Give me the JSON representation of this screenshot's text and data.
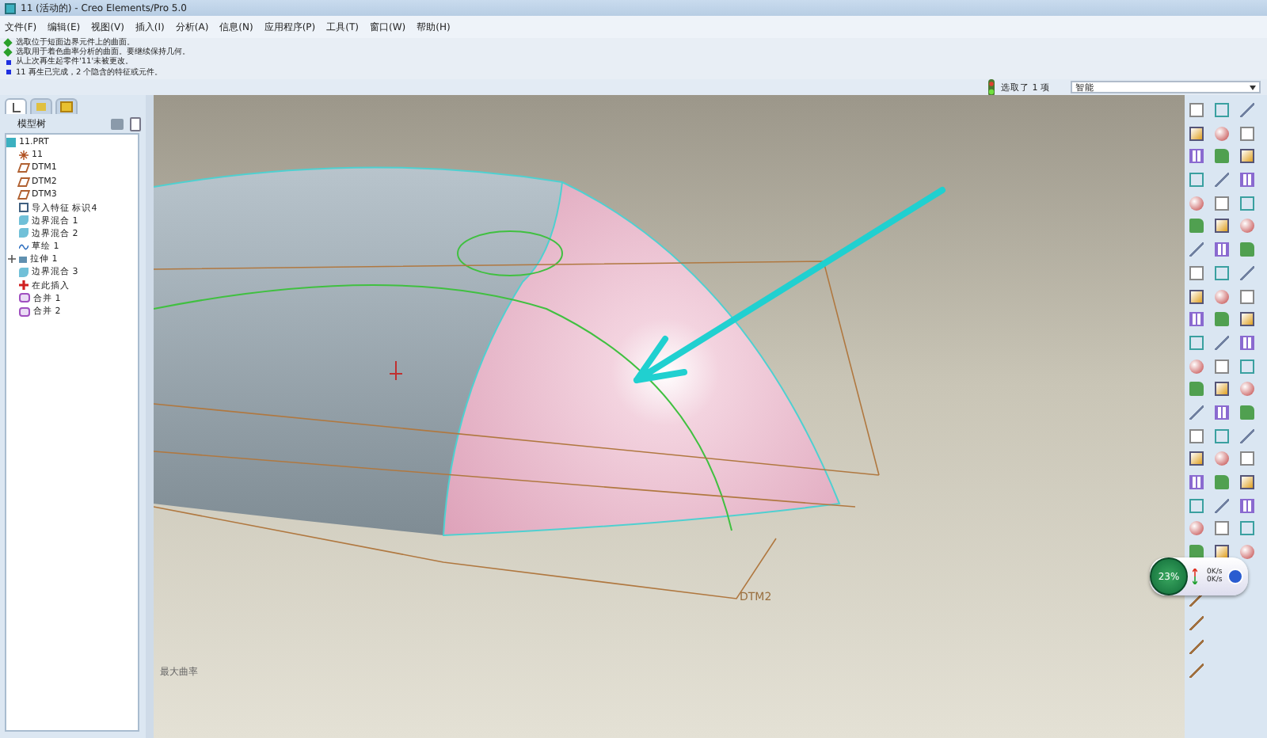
{
  "window": {
    "title": "11 (活动的) - Creo Elements/Pro 5.0"
  },
  "menu": [
    "文件(F)",
    "编辑(E)",
    "视图(V)",
    "插入(I)",
    "分析(A)",
    "信息(N)",
    "应用程序(P)",
    "工具(T)",
    "窗口(W)",
    "帮助(H)"
  ],
  "messages": [
    {
      "kind": "prompt",
      "text": "选取位于短面边界元件上的曲面。"
    },
    {
      "kind": "prompt",
      "text": "选取用于着色曲率分析的曲面。要继续保持几何。"
    },
    {
      "kind": "info",
      "text": "从上次再生起零件'11'未被更改。"
    },
    {
      "kind": "info",
      "text": "11 再生已完成，2 个隐含的特征或元件。"
    }
  ],
  "selection": {
    "status": "选取了 1 项",
    "filter": "智能"
  },
  "model_tree": {
    "tabs": [
      {
        "selected": true
      },
      {
        "selected": false
      },
      {
        "selected": false
      }
    ],
    "title": "模型树",
    "items": [
      {
        "kind": "part",
        "label": "11.PRT",
        "collapsed": false
      },
      {
        "kind": "csys",
        "label": "11",
        "collapsed": false
      },
      {
        "kind": "datum",
        "label": "DTM1",
        "collapsed": false
      },
      {
        "kind": "datum",
        "label": "DTM2",
        "collapsed": false
      },
      {
        "kind": "datum",
        "label": "DTM3",
        "collapsed": false
      },
      {
        "kind": "import",
        "label": "导入特征 标识4",
        "collapsed": false
      },
      {
        "kind": "blend",
        "label": "边界混合 1",
        "collapsed": false
      },
      {
        "kind": "blend",
        "label": "边界混合 2",
        "collapsed": false
      },
      {
        "kind": "sketch",
        "label": "草绘 1",
        "collapsed": false
      },
      {
        "kind": "extrude",
        "label": "拉伸 1",
        "collapsed": true
      },
      {
        "kind": "blend",
        "label": "边界混合 3",
        "collapsed": false
      },
      {
        "kind": "insert",
        "label": "在此插入",
        "collapsed": false
      },
      {
        "kind": "merge",
        "label": "合并 1",
        "collapsed": false
      },
      {
        "kind": "merge",
        "label": "合并 2",
        "collapsed": false
      }
    ]
  },
  "viewport": {
    "datum_label": "DTM2",
    "corner_note": "最大曲率"
  },
  "meter": {
    "percent": "23%",
    "upload": "0K/s",
    "download": "0K/s"
  }
}
